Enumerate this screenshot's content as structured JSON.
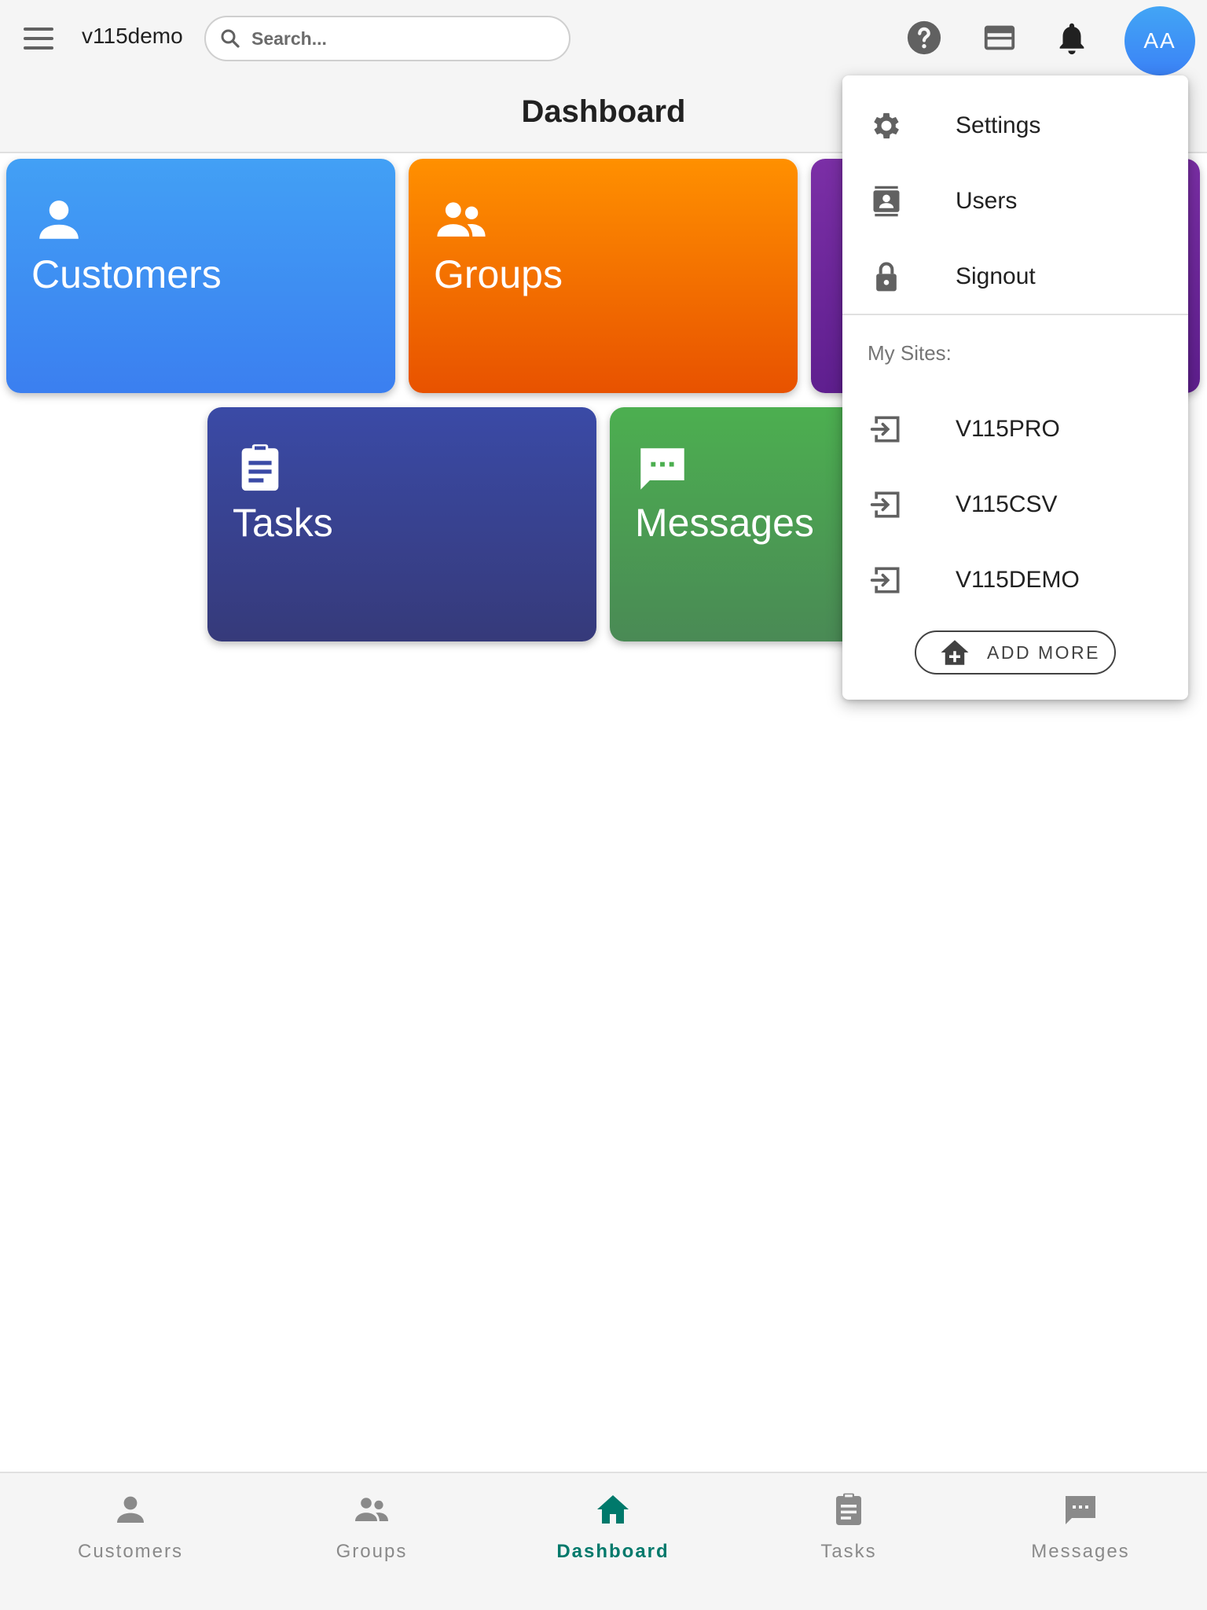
{
  "header": {
    "app_name": "v115demo",
    "search_placeholder": "Search...",
    "avatar_initials": "AA",
    "icons": [
      "menu-icon",
      "search-icon",
      "help-icon",
      "credit-card-icon",
      "notification-bell-icon"
    ]
  },
  "page": {
    "title": "Dashboard"
  },
  "tiles": [
    {
      "label": "Customers",
      "icon": "person-icon",
      "color": "#3b82f6"
    },
    {
      "label": "Groups",
      "icon": "people-icon",
      "color": "#f57c00"
    },
    {
      "label": "",
      "icon": "",
      "color": "#6a1b9a"
    },
    {
      "label": "Tasks",
      "icon": "clipboard-icon",
      "color": "#3949ab"
    },
    {
      "label": "Messages",
      "icon": "chat-icon",
      "color": "#4caf50"
    }
  ],
  "dropdown": {
    "items": [
      {
        "label": "Settings",
        "icon": "gear-icon"
      },
      {
        "label": "Users",
        "icon": "contact-card-icon"
      },
      {
        "label": "Signout",
        "icon": "lock-icon"
      }
    ],
    "sites_heading": "My Sites:",
    "sites": [
      {
        "label": "V115PRO",
        "icon": "login-icon"
      },
      {
        "label": "V115CSV",
        "icon": "login-icon"
      },
      {
        "label": "V115DEMO",
        "icon": "login-icon"
      }
    ],
    "add_more_label": "ADD MORE"
  },
  "bottom_nav": {
    "items": [
      {
        "label": "Customers",
        "icon": "person-icon",
        "active": false
      },
      {
        "label": "Groups",
        "icon": "people-icon",
        "active": false
      },
      {
        "label": "Dashboard",
        "icon": "home-icon",
        "active": true
      },
      {
        "label": "Tasks",
        "icon": "clipboard-icon",
        "active": false
      },
      {
        "label": "Messages",
        "icon": "chat-icon",
        "active": false
      }
    ],
    "active_color": "#00796b",
    "inactive_color": "#8a8a8a"
  }
}
